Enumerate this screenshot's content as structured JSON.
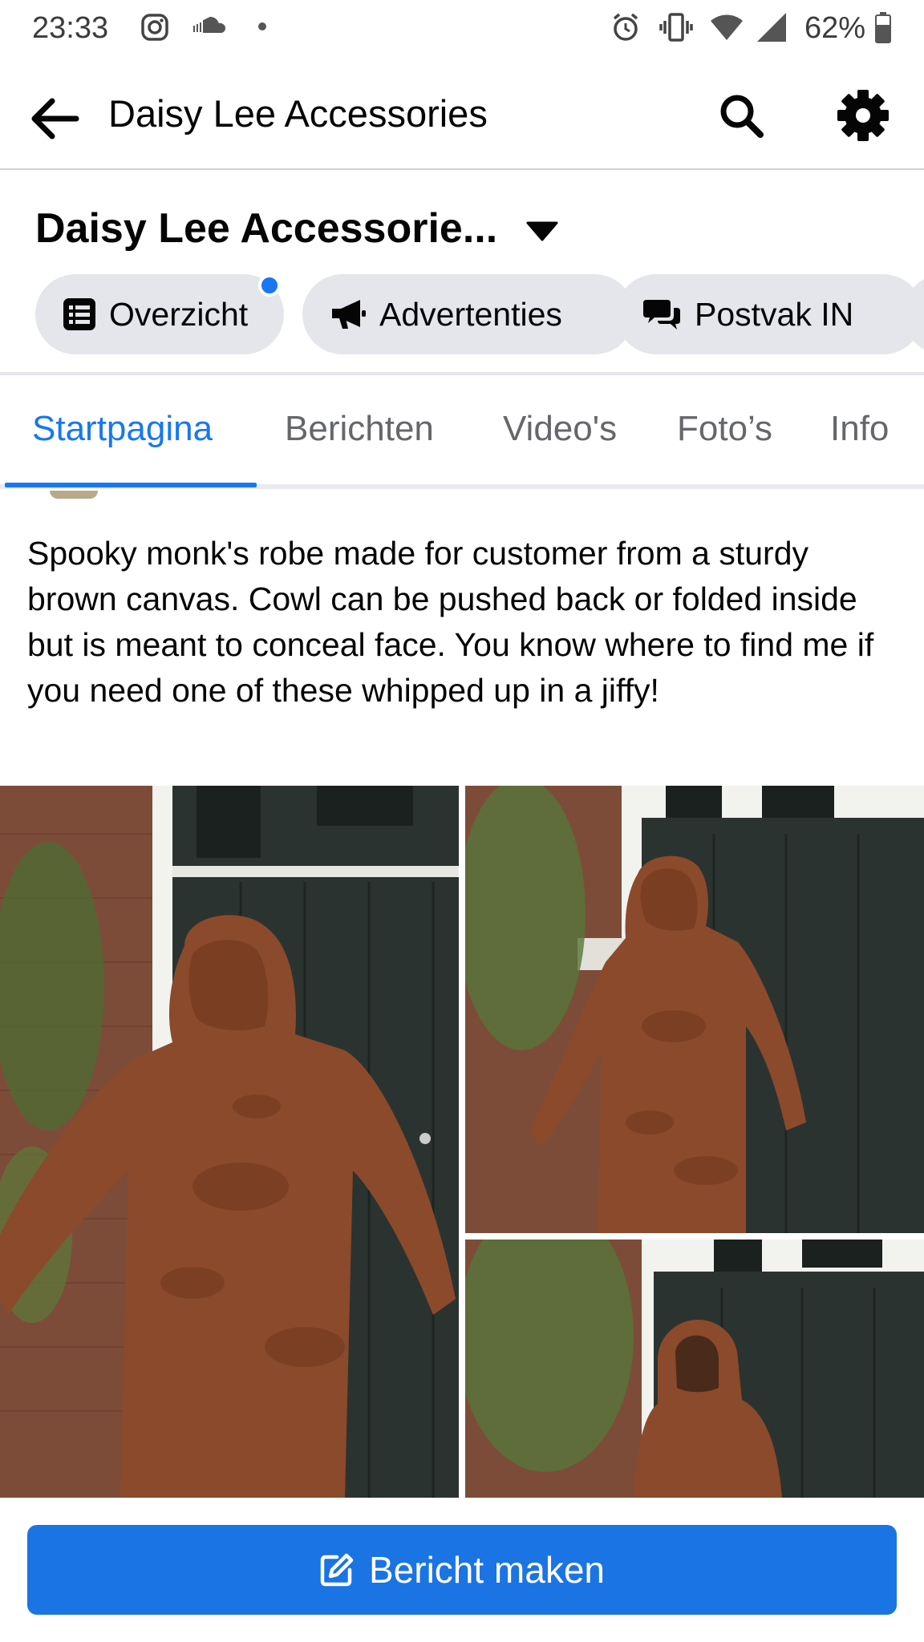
{
  "status_bar": {
    "time": "23:33",
    "battery": "62%",
    "icons": [
      "instagram-icon",
      "soundcloud-icon",
      "dot-icon",
      "alarm-icon",
      "vibrate-icon",
      "wifi-icon",
      "signal-icon",
      "battery-icon"
    ]
  },
  "header": {
    "title": "Daisy Lee Accessories",
    "icons": [
      "back-arrow-icon",
      "search-icon",
      "gear-icon"
    ]
  },
  "page": {
    "name": "Daisy Lee Accessorie..."
  },
  "pills": [
    {
      "label": "Overzicht",
      "icon": "list-icon",
      "has_notification": true
    },
    {
      "label": "Advertenties",
      "icon": "megaphone-icon"
    },
    {
      "label": "Postvak IN",
      "icon": "chat-icon"
    }
  ],
  "tabs": [
    {
      "label": "Startpagina",
      "active": true
    },
    {
      "label": "Berichten"
    },
    {
      "label": "Video's"
    },
    {
      "label": "Foto’s"
    },
    {
      "label": "Info"
    }
  ],
  "post": {
    "text": "Spooky monk's robe made for customer from a sturdy brown canvas. Cowl can be pushed back or folded inside but is meant to conceal face. You know where to find me if you need one of these whipped up in a jiffy!",
    "photos": [
      "robe-photo-front",
      "robe-photo-side",
      "robe-photo-hood"
    ]
  },
  "bottom": {
    "create_label": "Bericht maken",
    "icon": "edit-icon"
  },
  "colors": {
    "accent": "#1877f2",
    "button": "#1b74e4",
    "pill_bg": "#e4e6eb",
    "muted_text": "#65676b",
    "robe": "#8b4a2b"
  }
}
